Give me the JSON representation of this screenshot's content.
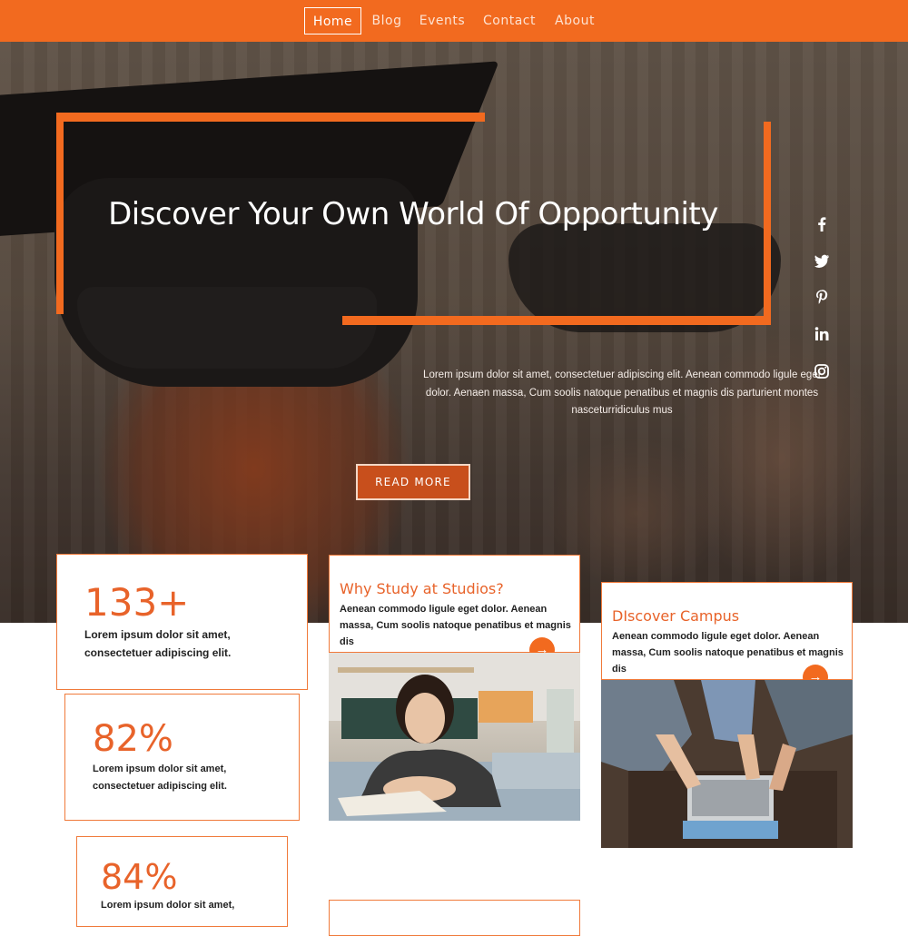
{
  "nav": {
    "items": [
      "Home",
      "Blog",
      "Events",
      "Contact",
      "About"
    ],
    "active": "Home"
  },
  "hero": {
    "title": "Discover Your Own World Of Opportunity",
    "description": "Lorem ipsum dolor sit amet, consectetuer adipiscing elit. Aenean commodo ligule eget dolor. Aenaen massa, Cum soolis natoque penatibus et magnis dis parturient montes nasceturridiculus mus",
    "button_label": "READ MORE"
  },
  "social_icons": [
    "facebook-icon",
    "twitter-icon",
    "pinterest-icon",
    "linkedin-icon",
    "instagram-icon"
  ],
  "stats": [
    {
      "value": "133+",
      "text": "Lorem ipsum dolor sit amet, consectetuer adipiscing elit."
    },
    {
      "value": "82%",
      "text": "Lorem ipsum dolor sit amet, consectetuer adipiscing elit."
    },
    {
      "value": "84%",
      "text": "Lorem ipsum dolor sit amet,"
    }
  ],
  "features": [
    {
      "title": "Why Study at Studios?",
      "text": "Aenean commodo ligule eget dolor. Aenean massa, Cum soolis natoque penatibus et magnis dis",
      "arrow": "→"
    },
    {
      "title": "DIscover Campus",
      "text": "Aenean commodo ligule eget dolor. Aenean massa, Cum soolis natoque penatibus et magnis dis",
      "arrow": "→"
    }
  ],
  "colors": {
    "accent": "#f26a1f",
    "stat_number": "#e8632a",
    "button_bg": "#c84f1c"
  }
}
